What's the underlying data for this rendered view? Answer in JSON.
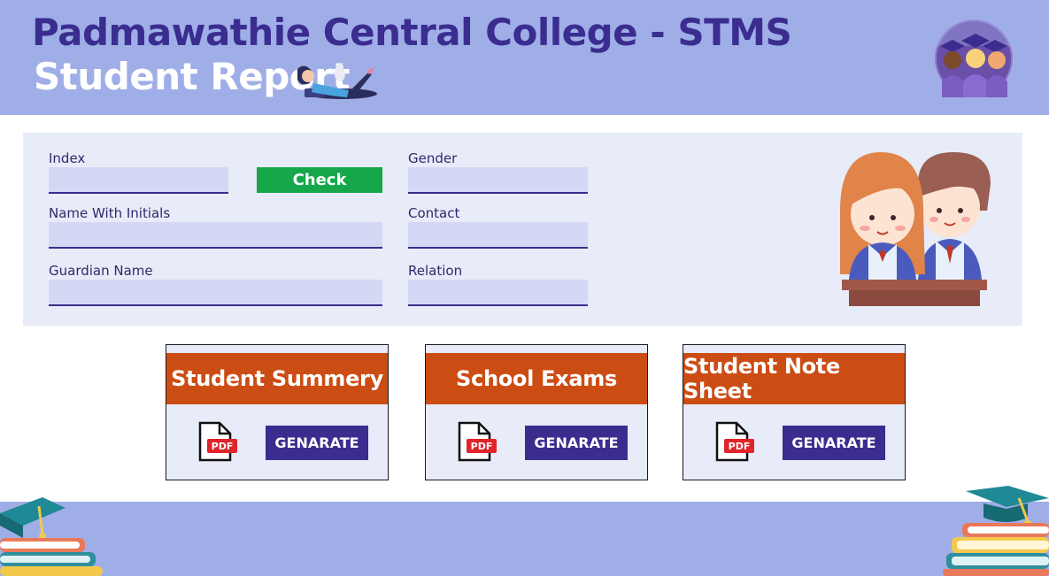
{
  "header": {
    "title": "Padmawathie Central College - STMS",
    "subtitle": "Student Report"
  },
  "form": {
    "index": {
      "label": "Index",
      "value": ""
    },
    "check_label": "Check",
    "gender": {
      "label": "Gender",
      "value": ""
    },
    "name_with_initials": {
      "label": "Name With Initials",
      "value": ""
    },
    "contact": {
      "label": "Contact",
      "value": ""
    },
    "guardian_name": {
      "label": "Guardian Name",
      "value": ""
    },
    "relation": {
      "label": "Relation",
      "value": ""
    }
  },
  "cards": [
    {
      "title": "Student Summery",
      "icon": "pdf-file-icon",
      "pdf_text": "PDF",
      "button": "GENARATE"
    },
    {
      "title": "School Exams",
      "icon": "pdf-file-icon",
      "pdf_text": "PDF",
      "button": "GENARATE"
    },
    {
      "title": "Student Note Sheet",
      "icon": "pdf-file-icon",
      "pdf_text": "PDF",
      "button": "GENARATE"
    }
  ],
  "colors": {
    "header_bg": "#a0aee8",
    "title": "#3a2d8f",
    "panel_bg": "#e8ebf8",
    "input_bg": "#d3d9f4",
    "check_button": "#15a74a",
    "card_header": "#cc4d14",
    "generate_button": "#3a2d8f",
    "pdf_red": "#e0242a"
  }
}
